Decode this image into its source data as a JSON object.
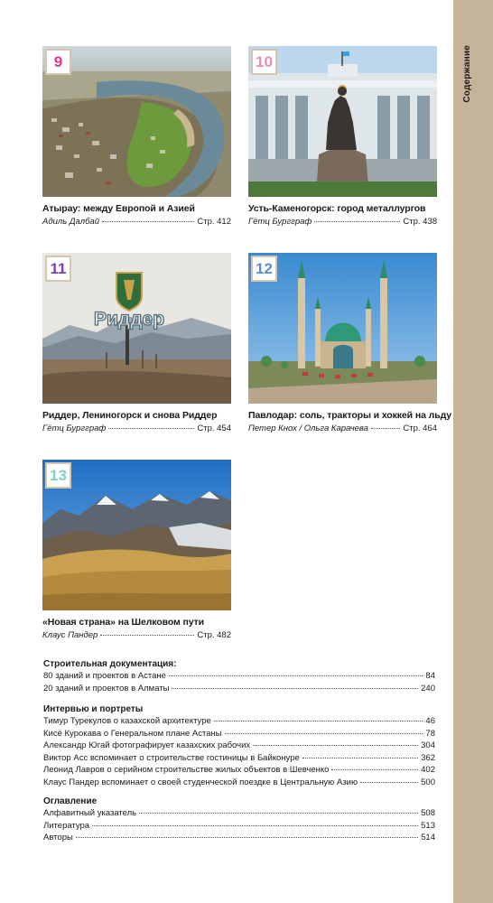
{
  "side_tab": {
    "label": "Содержание"
  },
  "articles": [
    {
      "number": "9",
      "number_color": "#e0348c",
      "title": "Атырау: между Европой и Азией",
      "author": "Адиль Далбай",
      "page": "Стр. 412"
    },
    {
      "number": "10",
      "number_color": "#f08ab8",
      "title": "Усть-Каменогорск: город металлургов",
      "author": "Гётц Бургграф",
      "page": "Стр. 438"
    },
    {
      "number": "11",
      "number_color": "#7a3cc0",
      "title": "Риддер, Лениногорск и снова Риддер",
      "author": "Гётц Бургграф",
      "page": "Стр. 454",
      "photo_sign_text": "Риддер"
    },
    {
      "number": "12",
      "number_color": "#5a8fd0",
      "title": "Павлодар: соль, тракторы и хоккей на льду",
      "author": "Петер Кнох / Ольга Карачева",
      "page": "Стр. 464"
    },
    {
      "number": "13",
      "number_color": "#7fd0c8",
      "title": "«Новая страна» на Шелковом пути",
      "author": "Клаус Пандер",
      "page": "Стр. 482"
    }
  ],
  "toc_sections": [
    {
      "heading": "Строительная документация:",
      "entries": [
        {
          "label": "80 зданий и проектов в Астане",
          "page": "84"
        },
        {
          "label": "20 зданий и проектов в Алматы",
          "page": "240"
        }
      ]
    },
    {
      "heading": "Интервью и портреты",
      "entries": [
        {
          "label": "Тимур Турекулов о казахской архитектуре",
          "page": "46"
        },
        {
          "label": "Кисё Курокава о Генеральном плане Астаны",
          "page": "78"
        },
        {
          "label": "Александр Югай фотографирует казахских рабочих",
          "page": "304"
        },
        {
          "label": "Виктор Асс вспоминает о строительстве гостиницы в Байконуре",
          "page": "362"
        },
        {
          "label": "Леонид Лавров о серийном строительстве жилых объектов в Шевченко",
          "page": "402"
        },
        {
          "label": "Клаус Пандер вспоминает о своей студенческой поездке в Центральную Азию",
          "page": "500"
        }
      ]
    },
    {
      "heading": "Оглавление",
      "entries": [
        {
          "label": "Алфавитный указатель",
          "page": "508"
        },
        {
          "label": "Литература",
          "page": "513"
        },
        {
          "label": "Авторы",
          "page": "514"
        }
      ]
    }
  ]
}
